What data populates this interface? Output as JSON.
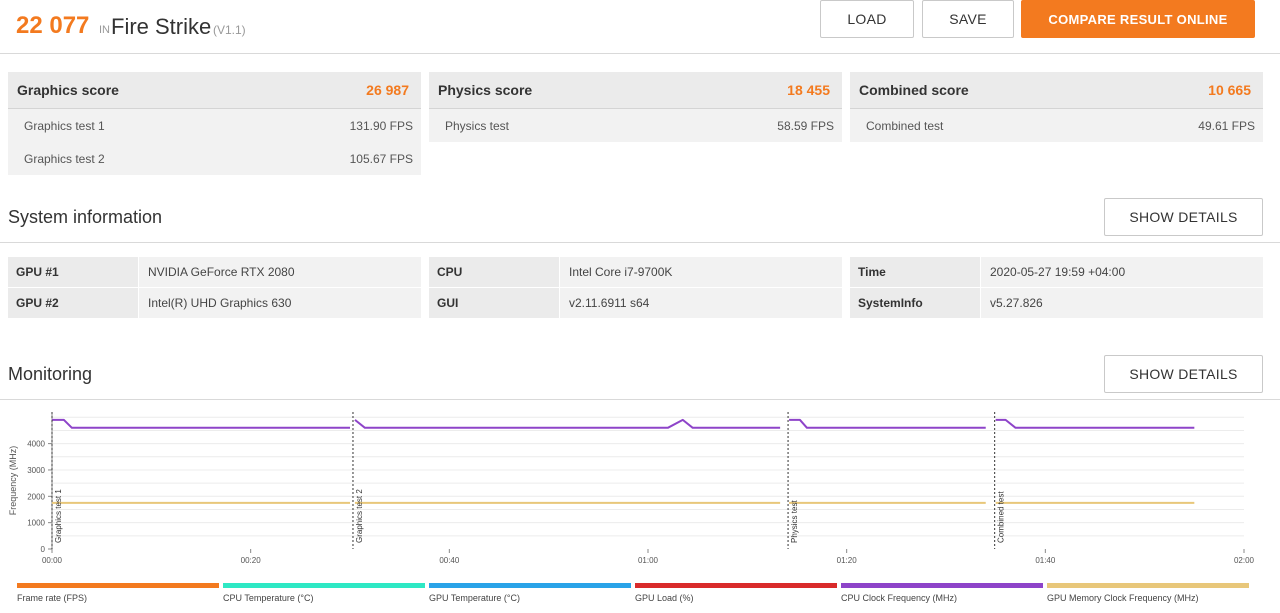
{
  "header": {
    "score": "22 077",
    "in_label": "IN",
    "test_name": "Fire Strike",
    "version": "(V1.1)",
    "load_label": "LOAD",
    "save_label": "SAVE",
    "compare_label": "COMPARE RESULT ONLINE"
  },
  "cards": [
    {
      "title": "Graphics score",
      "value": "26 987",
      "rows": [
        {
          "name": "Graphics test 1",
          "value": "131.90 FPS"
        },
        {
          "name": "Graphics test 2",
          "value": "105.67 FPS"
        }
      ]
    },
    {
      "title": "Physics score",
      "value": "18 455",
      "rows": [
        {
          "name": "Physics test",
          "value": "58.59 FPS"
        }
      ]
    },
    {
      "title": "Combined score",
      "value": "10 665",
      "rows": [
        {
          "name": "Combined test",
          "value": "49.61 FPS"
        }
      ]
    }
  ],
  "system": {
    "title": "System information",
    "details_label": "SHOW DETAILS",
    "columns": [
      [
        {
          "key": "GPU #1",
          "value": "NVIDIA GeForce RTX 2080"
        },
        {
          "key": "GPU #2",
          "value": "Intel(R) UHD Graphics 630"
        }
      ],
      [
        {
          "key": "CPU",
          "value": "Intel Core i7-9700K"
        },
        {
          "key": "GUI",
          "value": "v2.11.6911 s64"
        }
      ],
      [
        {
          "key": "Time",
          "value": "2020-05-27 19:59 +04:00"
        },
        {
          "key": "SystemInfo",
          "value": "v5.27.826"
        }
      ]
    ]
  },
  "monitoring": {
    "title": "Monitoring",
    "details_label": "SHOW DETAILS"
  },
  "chart_data": {
    "type": "line",
    "ylabel": "Frequency (MHz)",
    "ylim": [
      0,
      5200
    ],
    "yticks": [
      0,
      1000,
      2000,
      3000,
      4000
    ],
    "ytick_labels": [
      "0",
      "1000",
      "2000",
      "3000",
      "4000"
    ],
    "xlim": [
      0,
      120
    ],
    "xticks": [
      0,
      20,
      40,
      60,
      80,
      100,
      120
    ],
    "xtick_labels": [
      "00:00",
      "00:20",
      "00:40",
      "01:00",
      "01:20",
      "01:40",
      "02:00"
    ],
    "grid": true,
    "markers": [
      {
        "x": 0,
        "label": "Graphics test 1"
      },
      {
        "x": 30.3,
        "label": "Graphics test 2"
      },
      {
        "x": 74.1,
        "label": "Physics test"
      },
      {
        "x": 94.9,
        "label": "Combined test"
      }
    ],
    "series": [
      {
        "name": "Frame rate (FPS)",
        "color": "#f37a1f",
        "segments": []
      },
      {
        "name": "CPU Temperature (°C)",
        "color": "#2ee8c4",
        "segments": []
      },
      {
        "name": "GPU Temperature (°C)",
        "color": "#2aa3e8",
        "segments": []
      },
      {
        "name": "GPU Load (%)",
        "color": "#d92b2b",
        "segments": []
      },
      {
        "name": "CPU Clock Frequency (MHz)",
        "color": "#8e44c9",
        "segments": [
          [
            [
              0,
              4900
            ],
            [
              1.2,
              4900
            ],
            [
              2,
              4600
            ],
            [
              10,
              4600
            ],
            [
              20,
              4600
            ],
            [
              30,
              4600
            ]
          ],
          [
            [
              30.5,
              4900
            ],
            [
              31.5,
              4600
            ],
            [
              45,
              4600
            ],
            [
              55,
              4600
            ],
            [
              62,
              4600
            ],
            [
              63.5,
              4900
            ],
            [
              64.5,
              4600
            ],
            [
              73.3,
              4600
            ]
          ],
          [
            [
              74.2,
              4900
            ],
            [
              75.3,
              4900
            ],
            [
              76,
              4600
            ],
            [
              85,
              4600
            ],
            [
              94,
              4600
            ]
          ],
          [
            [
              95,
              4900
            ],
            [
              96,
              4900
            ],
            [
              97,
              4600
            ],
            [
              105,
              4600
            ],
            [
              115,
              4600
            ]
          ]
        ]
      },
      {
        "name": "GPU Memory Clock Frequency (MHz)",
        "color": "#e8c77a",
        "segments": [
          [
            [
              0,
              1750
            ],
            [
              30,
              1750
            ]
          ],
          [
            [
              30.5,
              1750
            ],
            [
              73.3,
              1750
            ]
          ],
          [
            [
              74.2,
              1750
            ],
            [
              94,
              1750
            ]
          ],
          [
            [
              95,
              1750
            ],
            [
              115,
              1750
            ]
          ]
        ]
      }
    ]
  }
}
